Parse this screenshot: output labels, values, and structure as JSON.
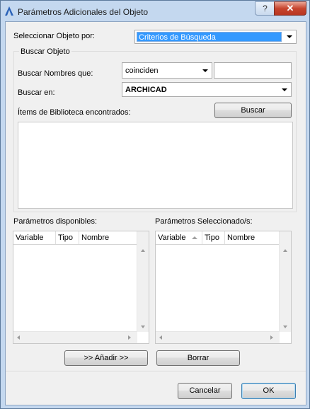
{
  "window": {
    "title": "Parámetros Adicionales del Objeto",
    "help_label": "?",
    "close_label": "✕"
  },
  "select_object": {
    "label": "Seleccionar Objeto por:",
    "value": "Criterios de Búsqueda"
  },
  "search_group": {
    "title": "Buscar Objeto",
    "names_label": "Buscar Nombres que:",
    "match_value": "coinciden",
    "name_input_value": "",
    "search_in_label": "Buscar en:",
    "search_in_value": "ARCHICAD",
    "found_label": "Ítems de Biblioteca encontrados:",
    "search_button": "Buscar"
  },
  "available_params": {
    "label": "Parámetros disponibles:",
    "columns": [
      "Variable",
      "Tipo",
      "Nombre"
    ]
  },
  "selected_params": {
    "label": "Parámetros Seleccionado/s:",
    "columns": [
      "Variable",
      "Tipo",
      "Nombre"
    ]
  },
  "actions": {
    "add_label": ">> Añadir >>",
    "clear_label": "Borrar",
    "cancel_label": "Cancelar",
    "ok_label": "OK"
  },
  "colors": {
    "selection": "#3399ff",
    "frame": "#c4d8ef",
    "close": "#c7452e"
  }
}
